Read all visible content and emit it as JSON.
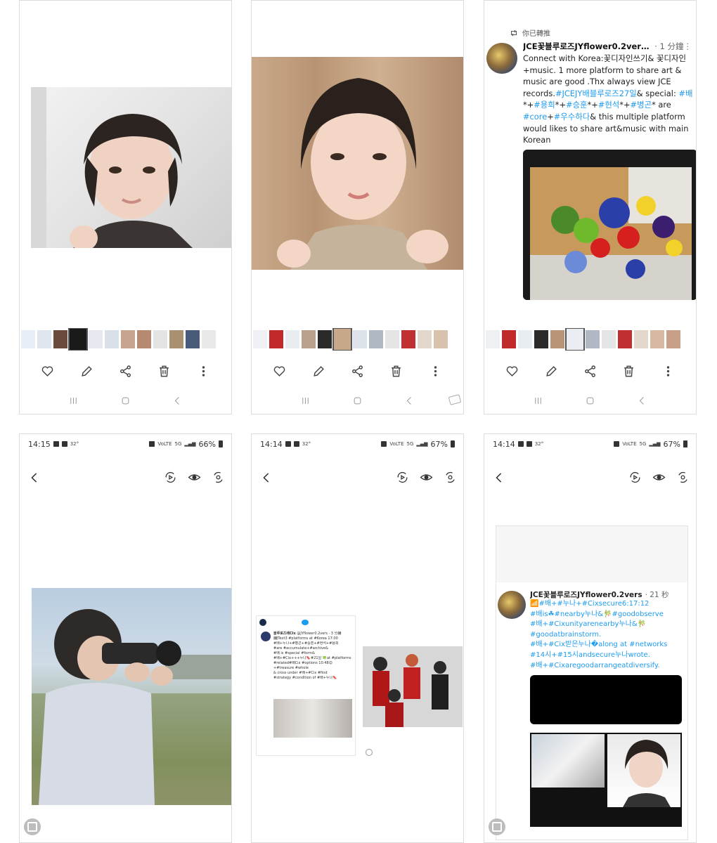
{
  "actions": {
    "like": "heart-icon",
    "edit": "pencil-icon",
    "share": "share-icon",
    "delete": "trash-icon",
    "more": "more-vertical-icon"
  },
  "tweet": {
    "retweet_label": "你已轉推",
    "author": "JCE꽃블루로즈JYflower0.2vers ...",
    "time": "· 1 分鐘",
    "more": "⋮",
    "body_parts": [
      {
        "t": "Connect with Korea:꽃디자인쓰기&",
        "hl": false
      },
      {
        "t": " 꽃디자인+music. 1 more platform to share art & music are good .Thx always view JCE records.",
        "hl": false
      },
      {
        "t": "#JCEJY배블루로즈27일",
        "hl": true
      },
      {
        "t": "& special: ",
        "hl": false
      },
      {
        "t": "#배",
        "hl": true
      },
      {
        "t": "*+",
        "hl": false
      },
      {
        "t": "#용희",
        "hl": true
      },
      {
        "t": "*+",
        "hl": false
      },
      {
        "t": "#승훈",
        "hl": true
      },
      {
        "t": "*+",
        "hl": false
      },
      {
        "t": "#현석",
        "hl": true
      },
      {
        "t": "*+",
        "hl": false
      },
      {
        "t": "#병곤",
        "hl": true
      },
      {
        "t": "* are ",
        "hl": false
      },
      {
        "t": "#core",
        "hl": true
      },
      {
        "t": "+",
        "hl": false
      },
      {
        "t": "#우수하다",
        "hl": true
      },
      {
        "t": "& this multiple platform would likes to share art&music with main Korean",
        "hl": false
      }
    ]
  },
  "screens": {
    "s4": {
      "time": "14:15",
      "temp": "32°",
      "battery": "66%"
    },
    "s5": {
      "time": "14:14",
      "temp": "32°",
      "battery": "67%"
    },
    "s6": {
      "time": "14:14",
      "temp": "32°",
      "battery": "67%"
    }
  },
  "tweet2": {
    "author": "JCE꽃블루로즈JYflower0.2vers",
    "time": "· 21 秒",
    "lines": [
      "📶#배+#누나+#Cixsecure6:17:12",
      "#배is☘#nearby누나&🎋#goodobserve",
      "#배+#Cixunityarenearby누나&🎋",
      "#goodatbrainstorm.",
      "#배+#Cix받은누나�along at #networks",
      "#14시+#15시andsecure누나wrote.",
      "#배+#Cixaregoodarrangeatdiversify."
    ]
  },
  "embedded": {
    "author": "블루로즈배CIx",
    "handle": "@JYflower0.2vers · 3 分鐘",
    "lines": [
      "🗓Text3 #platforms at #Korea 17:00",
      "#배+누나+#병곤+#승훈+#현석+#용희",
      "#are #accumulate+#archive&",
      "#배 is #special #form&",
      "#배+#Cix+++누나🔖#21일 🍀at #platforms",
      "#related#배Cix #options 10:48😊",
      "+#treasure #whole",
      "& cross under #배+#Cix #find",
      "#strategy #condition of #배+누나🔖"
    ]
  },
  "colors": {
    "hashtag": "#1d9bf0",
    "icon": "#444444",
    "nav": "#999999"
  }
}
